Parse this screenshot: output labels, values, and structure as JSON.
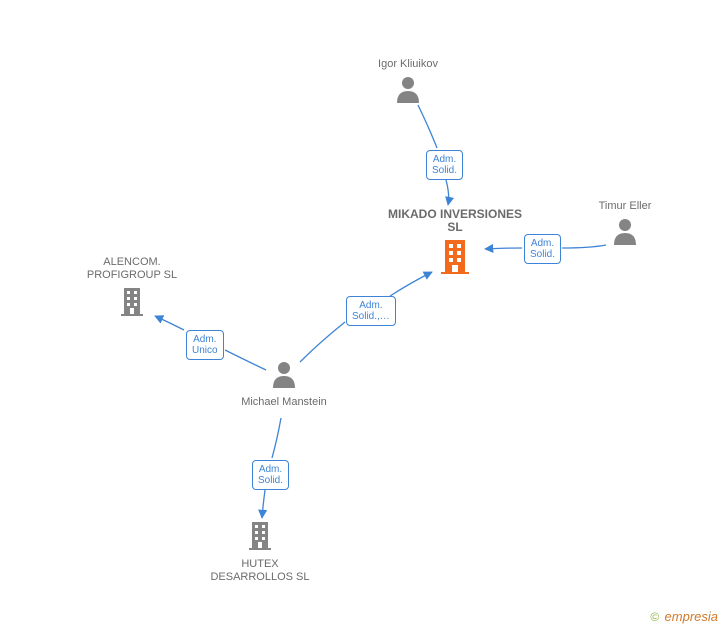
{
  "center": {
    "name": "MIKADO INVERSIONES SL"
  },
  "nodes": {
    "igor": {
      "label": "Igor Kliuikov",
      "type": "person"
    },
    "timur": {
      "label": "Timur Eller",
      "type": "person"
    },
    "michael": {
      "label": "Michael Manstein",
      "type": "person"
    },
    "alencom": {
      "label": "ALENCOM. PROFIGROUP SL",
      "type": "company"
    },
    "hutex": {
      "label": "HUTEX DESARROLLOS SL",
      "type": "company"
    }
  },
  "relations": {
    "igor_center": "Adm.\nSolid.",
    "timur_center": "Adm.\nSolid.",
    "michael_center": "Adm.\nSolid.,…",
    "michael_alencom": "Adm.\nUnico",
    "michael_hutex": "Adm.\nSolid."
  },
  "footer": {
    "copyright": "©",
    "brand": "empresia"
  },
  "colors": {
    "icon_gray": "#848484",
    "edge_blue": "#3e84d6",
    "center_orange": "#f26a1b"
  }
}
